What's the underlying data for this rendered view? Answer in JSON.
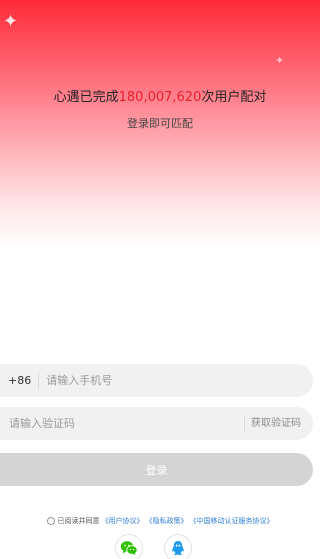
{
  "header": {
    "headline_prefix": "心遇已完成",
    "match_count": "180,007,620",
    "headline_suffix": "次用户配对",
    "subtitle": "登录即可匹配"
  },
  "phone_field": {
    "country_code": "+86",
    "placeholder": "请输入手机号"
  },
  "code_field": {
    "placeholder": "请输入验证码",
    "get_code_label": "获取验证码"
  },
  "login_button": {
    "label": "登录"
  },
  "agreement": {
    "prefix": "已阅读并同意",
    "links": [
      "《用户协议》",
      "《隐私政策》",
      "《中国移动认证服务协议》"
    ]
  },
  "social_login": [
    "wechat-icon",
    "qq-icon"
  ],
  "colors": {
    "accent": "#e8202d",
    "link": "#2f7fd8",
    "wechat": "#2dc100",
    "qq": "#1e9bf0"
  }
}
